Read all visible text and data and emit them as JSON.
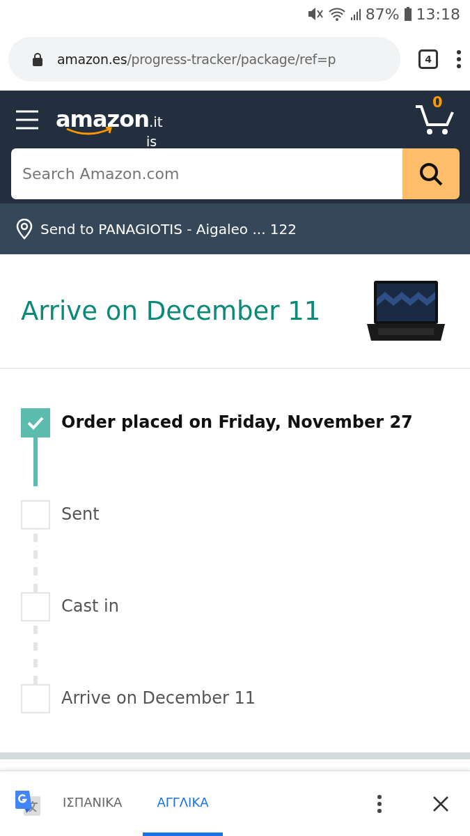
{
  "status_bar": {
    "battery": "87%",
    "time": "13:18"
  },
  "browser": {
    "url_host": "amazon.es",
    "url_path": "/progress-tracker/package/ref=p",
    "tab_count": "4"
  },
  "header": {
    "logo": "amazon",
    "logo_suffix": ".it",
    "logo_sub": "is",
    "cart_count": "0"
  },
  "search": {
    "placeholder": "Search Amazon.com"
  },
  "location": {
    "text": "Send to PANAGIOTIS - Aigaleo ... 122"
  },
  "delivery": {
    "title": "Arrive on December 11"
  },
  "steps": [
    {
      "label": "Order placed on Friday, November 27",
      "checked": true
    },
    {
      "label": "Sent",
      "checked": false
    },
    {
      "label": "Cast in",
      "checked": false
    },
    {
      "label": "Arrive on December 11",
      "checked": false
    }
  ],
  "translate_bar": {
    "languages": [
      {
        "label": "ΙΣΠΑΝΙΚΑ",
        "selected": false
      },
      {
        "label": "ΑΓΓΛΙΚΑ",
        "selected": true
      }
    ]
  }
}
